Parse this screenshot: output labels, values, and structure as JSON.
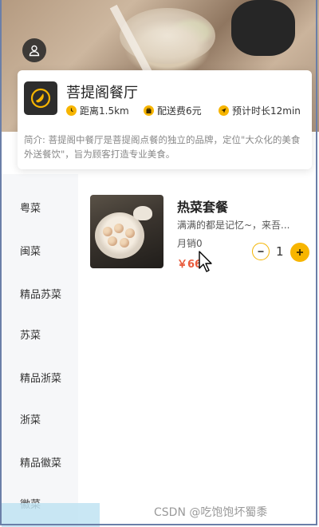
{
  "shop": {
    "name": "菩提阁餐厅",
    "distance": "距离1.5km",
    "delivery_fee": "配送费6元",
    "eta": "预计时长12min",
    "intro": "简介: 菩提阁中餐厅是菩提阁点餐的独立的品牌，定位\"大众化的美食外送餐饮\"，旨为顾客打造专业美食。"
  },
  "menu": {
    "items": [
      "粤菜",
      "闽菜",
      "精品苏菜",
      "苏菜",
      "精品浙菜",
      "浙菜",
      "精品徽菜",
      "徽菜"
    ]
  },
  "dish": {
    "title": "热菜套餐",
    "description": "满满的都是记忆~，来吾...",
    "sales": "月销0",
    "price": "￥66",
    "quantity": "1"
  },
  "icons": {
    "avatar": "user-icon",
    "logo": "restaurant-logo-icon",
    "distance": "clock-icon",
    "delivery": "bag-icon",
    "eta": "location-arrow-icon",
    "minus": "minus-icon",
    "plus": "plus-icon",
    "cursor": "mouse-pointer-icon"
  },
  "colors": {
    "accent": "#f7b500",
    "price": "#e85b3c",
    "menu_bg": "#f6f7f9"
  },
  "watermark": "CSDN @吃饱饱坏蜀黍"
}
